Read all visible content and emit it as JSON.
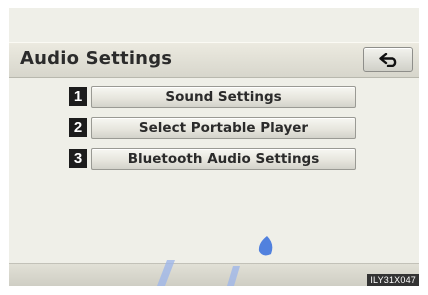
{
  "header": {
    "title": "Audio Settings",
    "back_icon": "return-arrow-icon"
  },
  "menu": {
    "items": [
      {
        "number": "1",
        "label": "Sound Settings"
      },
      {
        "number": "2",
        "label": "Select Portable Player"
      },
      {
        "number": "3",
        "label": "Bluetooth Audio Settings"
      }
    ]
  },
  "footer": {
    "code": "ILY31X047"
  },
  "colors": {
    "screen_background": "#efefe8",
    "number_badge": "#1c1c1c",
    "deco_blue": "#3a6fd8"
  }
}
